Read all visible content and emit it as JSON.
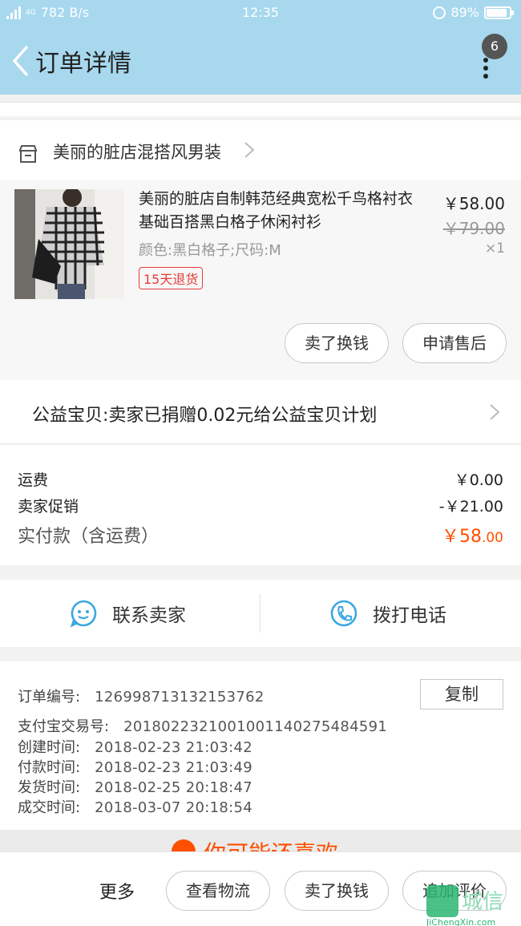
{
  "status_bar": {
    "network": "4G",
    "speed": "782 B/s",
    "time": "12:35",
    "battery": "89%",
    "battery_level": 0.89
  },
  "header": {
    "title": "订单详情",
    "badge_count": "6"
  },
  "shop": {
    "name": "美丽的脏店混搭风男装"
  },
  "product": {
    "name": "美丽的脏店自制韩范经典宽松千鸟格衬衣基础百搭黑白格子休闲衬衫",
    "spec": "颜色:黑白格子;尺码:M",
    "return_tag": "15天退货",
    "price": "￥58.00",
    "original_price": "￥79.00",
    "quantity": "×1",
    "buttons": {
      "sell": "卖了换钱",
      "after_sale": "申请售后"
    }
  },
  "charity": {
    "text": "公益宝贝:卖家已捐赠0.02元给公益宝贝计划"
  },
  "fees": {
    "shipping_label": "运费",
    "shipping_value": "￥0.00",
    "promo_label": "卖家促销",
    "promo_value": "-￥21.00",
    "paid_label": "实付款（含运费）",
    "paid_currency": "￥",
    "paid_int": "58",
    "paid_dec": ".00"
  },
  "contact": {
    "seller": "联系卖家",
    "phone": "拨打电话"
  },
  "order_info": {
    "order_no_label": "订单编号:",
    "order_no": "126998713132153762",
    "copy": "复制",
    "alipay_label": "支付宝交易号:",
    "alipay_no": "2018022321001001140275484591",
    "created_label": "创建时间:",
    "created": "2018-02-23 21:03:42",
    "paid_label": "付款时间:",
    "paid": "2018-02-23 21:03:49",
    "shipped_label": "发货时间:",
    "shipped": "2018-02-25 20:18:47",
    "completed_label": "成交时间:",
    "completed": "2018-03-07 20:18:54"
  },
  "recommend": {
    "text": "你可能还喜欢"
  },
  "bottom_bar": {
    "more": "更多",
    "logistics": "查看物流",
    "sell": "卖了换钱",
    "review": "追加评价"
  },
  "watermark": {
    "text": "城信",
    "sub": "JiChengXin.com"
  },
  "colors": {
    "header_bg": "#a7d8ee",
    "price_orange": "#ff5000",
    "tag_red": "#e63b3b",
    "icon_blue": "#3ba8e0"
  }
}
